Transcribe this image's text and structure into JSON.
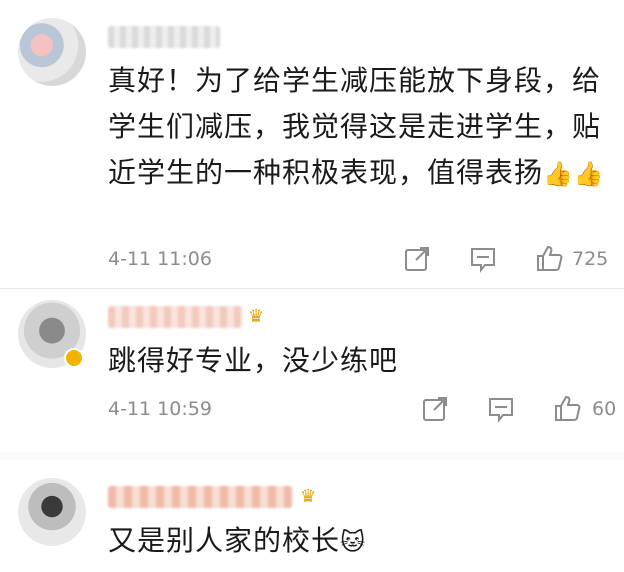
{
  "comments": [
    {
      "text": "真好！为了给学生减压能放下身段，给学生们减压，我觉得这是走进学生，贴近学生的一种积极表现，值得表扬",
      "emoji": "👍👍",
      "time": "4-11 11:06",
      "likes": "725",
      "has_crown": false
    },
    {
      "text": "跳得好专业，没少练吧",
      "emoji": "",
      "time": "4-11 10:59",
      "likes": "60",
      "has_crown": true
    },
    {
      "text": "又是别人家的校长",
      "emoji": "🐱",
      "has_crown": true
    }
  ],
  "icons": {
    "share": "share-icon",
    "comment": "comment-icon",
    "like": "thumbs-up-icon",
    "crown": "crown-badge-icon"
  },
  "colors": {
    "meta_gray": "#8c8c8c",
    "badge_gold": "#f2b400"
  }
}
